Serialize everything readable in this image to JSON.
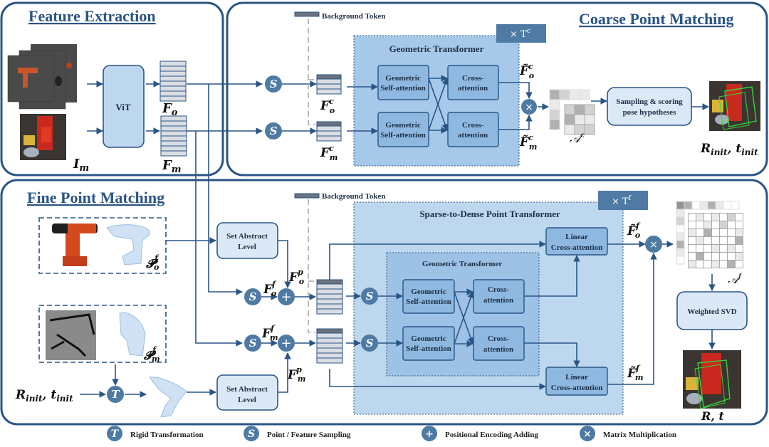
{
  "panels": {
    "feature_extraction": {
      "title": "Feature Extraction"
    },
    "coarse": {
      "title": "Coarse Point Matching"
    },
    "fine": {
      "title": "Fine Point Matching"
    }
  },
  "feature_extraction": {
    "vit_label": "ViT",
    "fo_label": "F",
    "fo_sub": "o",
    "fm_label": "F",
    "fm_sub": "m",
    "im_label": "I",
    "im_sub": "m"
  },
  "coarse": {
    "background_token": "Background Token",
    "repeat_label": "× T",
    "repeat_sup": "c",
    "transformer_title": "Geometric Transformer",
    "self_attn_1": [
      "Geometric",
      "Self-attention"
    ],
    "self_attn_2": [
      "Geometric",
      "Self-attention"
    ],
    "cross_attn_1": [
      "Cross-",
      "attention"
    ],
    "cross_attn_2": [
      "Cross-",
      "attention"
    ],
    "fco": {
      "base": "F",
      "sup": "c",
      "sub": "o"
    },
    "fcm": {
      "base": "F",
      "sup": "c",
      "sub": "m"
    },
    "fco_tilde": {
      "base": "F̃",
      "sup": "c",
      "sub": "o"
    },
    "fcm_tilde": {
      "base": "F̃",
      "sup": "c",
      "sub": "m"
    },
    "assign_label": "𝒜",
    "assign_sup": "c",
    "hypotheses": [
      "Sampling & scoring",
      "pose hypotheses"
    ],
    "output_label": "R",
    "output_sub": "init",
    "output_label2": "t",
    "output_sub2": "init"
  },
  "fine": {
    "background_token": "Background Token",
    "repeat_label": "× T",
    "repeat_sup": "f",
    "outer_title": "Sparse-to-Dense Point Transformer",
    "inner_title": "Geometric Transformer",
    "self_attn_1": [
      "Geometric",
      "Self-attention"
    ],
    "self_attn_2": [
      "Geometric",
      "Self-attention"
    ],
    "cross_attn_1": [
      "Cross-",
      "attention"
    ],
    "cross_attn_2": [
      "Cross-",
      "attention"
    ],
    "linear_1": [
      "Linear",
      "Cross-attention"
    ],
    "linear_2": [
      "Linear",
      "Cross-attention"
    ],
    "set_abstract_1": [
      "Set Abstract",
      "Level"
    ],
    "set_abstract_2": [
      "Set Abstract",
      "Level"
    ],
    "po": {
      "base": "𝓟",
      "sup": "f",
      "sub": "o"
    },
    "pm": {
      "base": "𝓟",
      "sup": "f",
      "sub": "m"
    },
    "ffo": {
      "base": "F",
      "sup": "f",
      "sub": "o"
    },
    "ffm": {
      "base": "F",
      "sup": "f",
      "sub": "m"
    },
    "fpo": {
      "base": "F",
      "sup": "p",
      "sub": "o"
    },
    "fpm": {
      "base": "F",
      "sup": "p",
      "sub": "m"
    },
    "ffo_tilde": {
      "base": "F̃",
      "sup": "f",
      "sub": "o"
    },
    "ffm_tilde": {
      "base": "F̃",
      "sup": "f",
      "sub": "m"
    },
    "assign_label": "𝒜",
    "assign_sup": "f",
    "svd": "Weighted SVD",
    "init_input": "R",
    "init_input_sub": "init",
    "init_input2": "t",
    "init_input2_sub": "init",
    "output": "R, t"
  },
  "legend": [
    {
      "symbol": "T",
      "label": "Rigid Transformation"
    },
    {
      "symbol": "S",
      "label": "Point / Feature Sampling"
    },
    {
      "symbol": "+",
      "label": "Positional Encoding Adding"
    },
    {
      "symbol": "×",
      "label": "Matrix Multiplication"
    }
  ],
  "colors": {
    "panel_border": "#2a5585",
    "node_fill": "#4e7aa3",
    "transformer_fill": "#8fb8e0",
    "box_fill": "#dbe9f6"
  }
}
